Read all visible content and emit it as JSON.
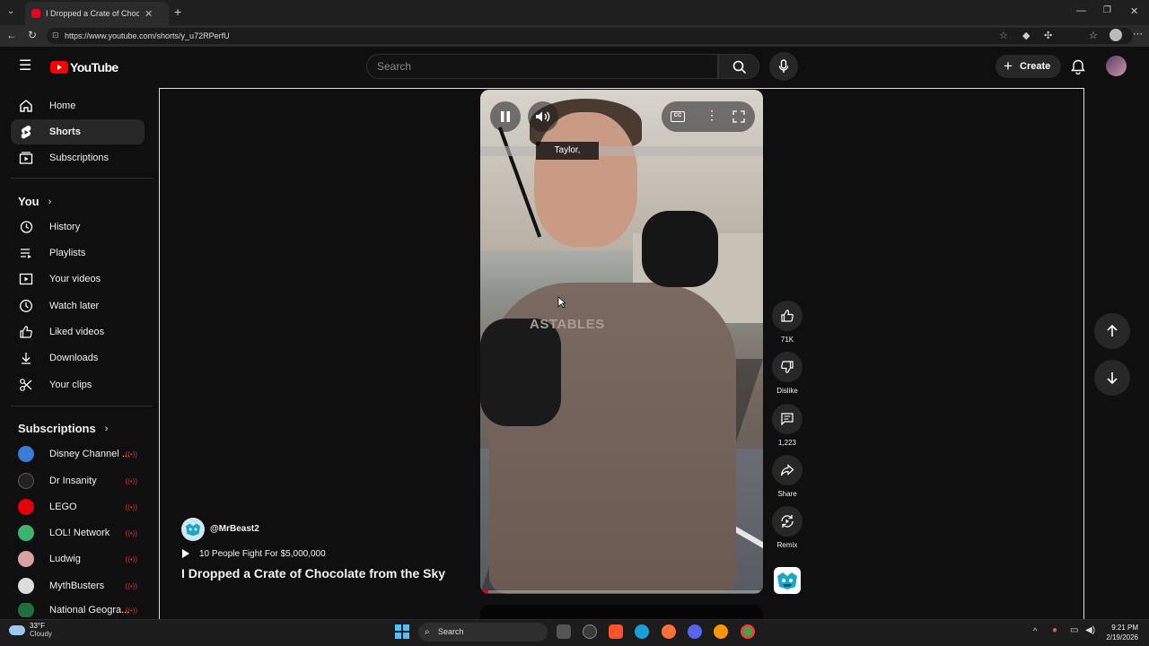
{
  "browser": {
    "tab_title": "I Dropped a Crate of Chocolat",
    "url": "https://www.youtube.com/shorts/y_u72RPerfU"
  },
  "header": {
    "logo_text": "YouTube",
    "search_placeholder": "Search",
    "create_label": "Create"
  },
  "sidebar": {
    "primary": [
      {
        "label": "Home",
        "icon": "home-icon"
      },
      {
        "label": "Shorts",
        "icon": "shorts-icon",
        "active": true
      },
      {
        "label": "Subscriptions",
        "icon": "subscriptions-icon"
      }
    ],
    "you_title": "You",
    "you_items": [
      {
        "label": "History",
        "icon": "history-icon"
      },
      {
        "label": "Playlists",
        "icon": "playlists-icon"
      },
      {
        "label": "Your videos",
        "icon": "your-videos-icon"
      },
      {
        "label": "Watch later",
        "icon": "watch-later-icon"
      },
      {
        "label": "Liked videos",
        "icon": "like-icon"
      },
      {
        "label": "Downloads",
        "icon": "download-icon"
      },
      {
        "label": "Your clips",
        "icon": "scissors-icon"
      }
    ],
    "subscriptions_title": "Subscriptions",
    "subscriptions": [
      {
        "label": "Disney Channel ...",
        "color": "#3a7bd5"
      },
      {
        "label": "Dr Insanity",
        "color": "#222222"
      },
      {
        "label": "LEGO",
        "color": "#e3000b"
      },
      {
        "label": "LOL! Network",
        "color": "#3cb371"
      },
      {
        "label": "Ludwig",
        "color": "#d9a0a0"
      },
      {
        "label": "MythBusters",
        "color": "#dddddd"
      },
      {
        "label": "National Geogra...",
        "color": "#1e6e3e"
      }
    ]
  },
  "video": {
    "caption": "Taylor,",
    "shirt_text": "ASTABLES",
    "progress": 0.03
  },
  "actions": {
    "likes": "71K",
    "dislike": "Dislike",
    "comments": "1,223",
    "share": "Share",
    "remix": "Remix"
  },
  "short": {
    "channel": "@MrBeast2",
    "playlist": "10 People Fight For $5,000,000",
    "title": "I Dropped a Crate of Chocolate from the Sky"
  },
  "taskbar": {
    "temp": "33°F",
    "condition": "Cloudy",
    "search_label": "Search",
    "time": "9:21 PM",
    "date": "2/19/2026"
  }
}
